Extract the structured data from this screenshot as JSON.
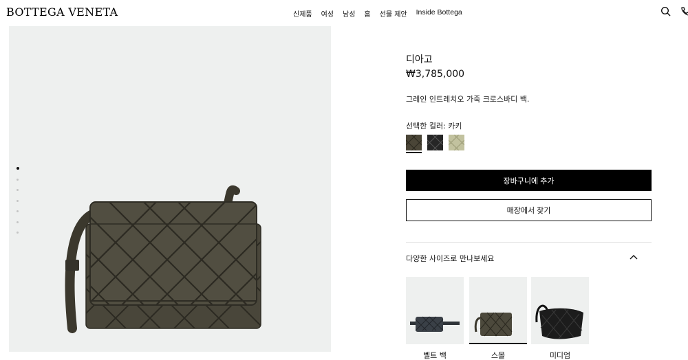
{
  "header": {
    "logo": "BOTTEGA VENETA",
    "nav": [
      "신제품",
      "여성",
      "남성",
      "홈",
      "선물 제안",
      "Inside Bottega"
    ],
    "icons": [
      "search-icon",
      "phone-icon"
    ]
  },
  "gallery": {
    "image_count": 7,
    "active_index": 0
  },
  "product": {
    "name": "디아고",
    "price": "₩3,785,000",
    "description": "그레인 인트레치오 가죽 크로스바디 백.",
    "color_label": "선택한 컬러: 카키",
    "swatches": [
      {
        "name": "카키",
        "color": "#4a4537",
        "selected": true
      },
      {
        "name": "블랙",
        "color": "#222222",
        "selected": false
      },
      {
        "name": "세이지",
        "color": "#bdbd9a",
        "selected": false
      }
    ],
    "add_to_cart": "장바구니에 추가",
    "find_in_store": "매장에서 찾기"
  },
  "sizes": {
    "title": "다양한 사이즈로 만나보세요",
    "items": [
      {
        "label": "벨트 백",
        "selected": false
      },
      {
        "label": "스몰",
        "selected": true
      },
      {
        "label": "미디엄",
        "selected": false
      }
    ]
  }
}
